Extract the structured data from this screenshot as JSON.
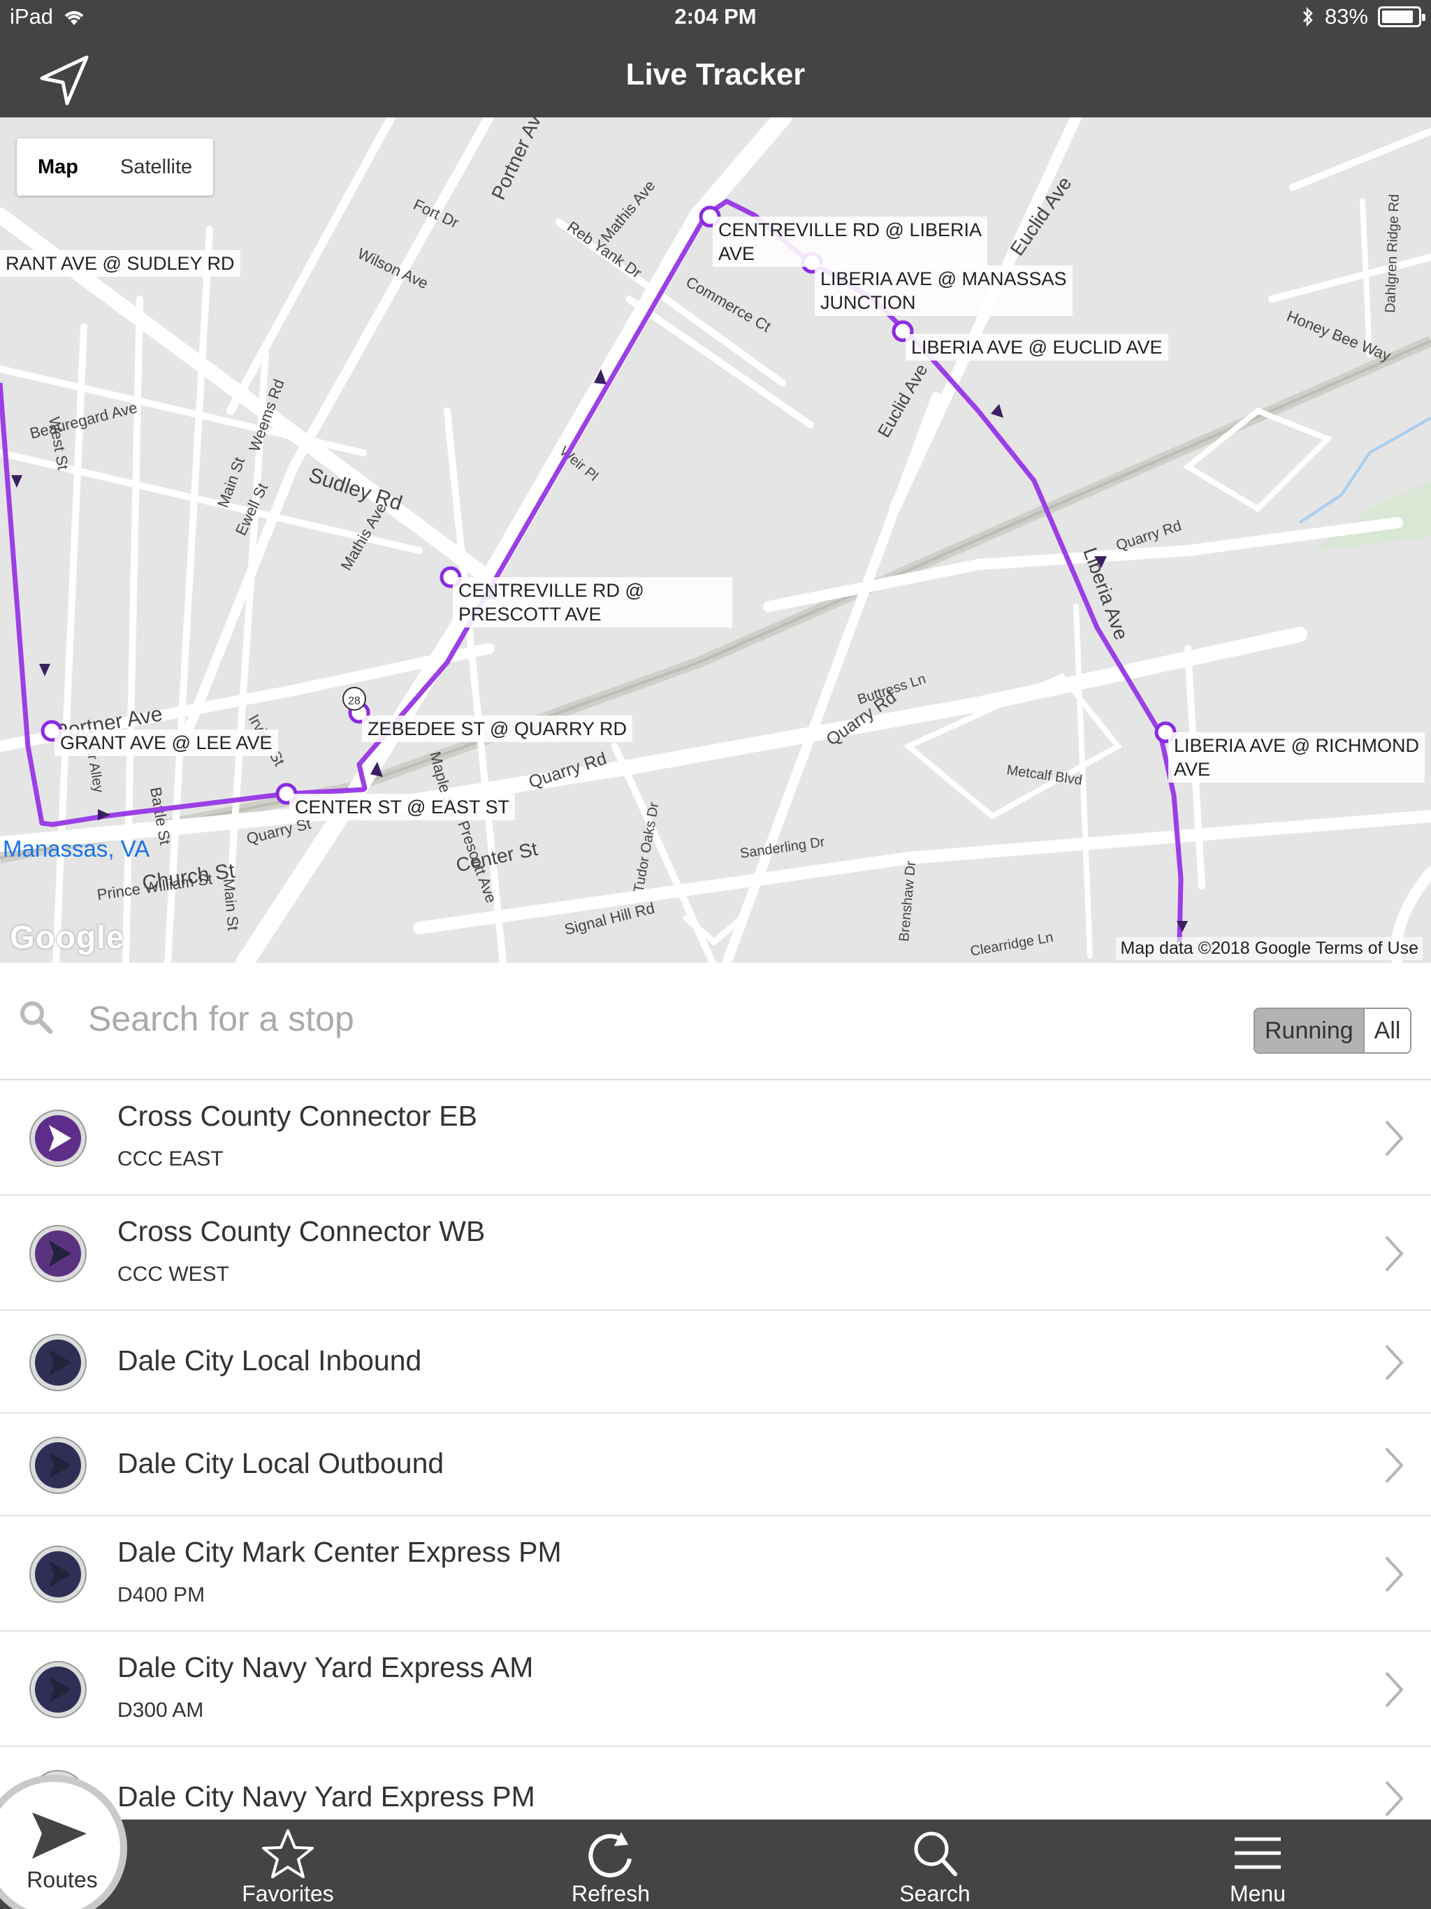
{
  "status": {
    "device": "iPad",
    "time": "2:04 PM",
    "battery": "83%"
  },
  "nav": {
    "title": "Live Tracker"
  },
  "map": {
    "toggle": [
      "Map",
      "Satellite"
    ],
    "town_label": "Manassas, VA",
    "attribution": "Map data ©2018 Google  Terms of Use",
    "logo": "Google",
    "stops": [
      "RANT AVE @ SUDLEY RD",
      "CENTREVILLE RD @ LIBERIA\nAVE",
      "LIBERIA AVE @ MANASSAS\nJUNCTION",
      "LIBERIA AVE @ EUCLID AVE",
      "CENTREVILLE RD @\nPRESCOTT AVE",
      "ZEBEDEE ST @ QUARRY RD",
      "GRANT AVE @ LEE AVE",
      "CENTER ST @ EAST ST",
      "LIBERIA AVE @ RICHMOND\nAVE"
    ],
    "street_names": [
      "Sudley Rd",
      "Portner Ave",
      "Church St",
      "Center St",
      "Quarry Rd",
      "Euclid Ave",
      "Liberia Ave",
      "Mathis Ave",
      "Signal Hill Rd",
      "Prince William St",
      "Fort Dr",
      "Wilson Ave",
      "Reb Yank Dr",
      "Commerce Ct",
      "Weir Pl",
      "Metcalf Blvd",
      "Honey Bee Way",
      "Beauregard Ave",
      "Battle St",
      "Maple St",
      "Main St",
      "Buttress Ln",
      "Sanderling Dr",
      "Tudor Oaks Dr",
      "Clearridge Ln",
      "Dahlgren Ridge Rd"
    ],
    "route_color": "#9b3fe6"
  },
  "search": {
    "placeholder": "Search for a stop",
    "filter": [
      "Running",
      "All"
    ]
  },
  "routes": [
    {
      "name": "Cross County Connector EB",
      "sub": "CCC EAST",
      "color": "#5e2d8a"
    },
    {
      "name": "Cross County Connector WB",
      "sub": "CCC WEST",
      "color": "#5a3380"
    },
    {
      "name": "Dale City Local Inbound",
      "sub": "",
      "color": "#2f2f55"
    },
    {
      "name": "Dale City Local Outbound",
      "sub": "",
      "color": "#2f2f55"
    },
    {
      "name": "Dale City Mark Center Express PM",
      "sub": "D400 PM",
      "color": "#2f2f55"
    },
    {
      "name": "Dale City Navy Yard Express AM",
      "sub": "D300 AM",
      "color": "#2f2f55"
    },
    {
      "name": "Dale City Navy Yard Express PM",
      "sub": "",
      "color": "#2f2f55"
    }
  ],
  "tabs": {
    "routes": "Routes",
    "favorites": "Favorites",
    "refresh": "Refresh",
    "search": "Search",
    "menu": "Menu"
  }
}
